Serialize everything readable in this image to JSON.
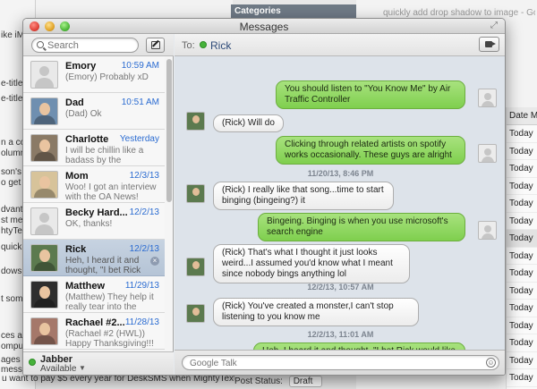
{
  "background": {
    "left_fragments": [
      "ike iM",
      "e-title.",
      "e-title.",
      "n a co",
      "olumn",
      "son's",
      "o get i",
      "dvanta",
      "st mes",
      "htyTex",
      "quick-re",
      "dows.",
      "t some",
      "ces ar",
      "omput",
      "ages w",
      "message"
    ],
    "categories_header": "Categories",
    "browser_tab": "quickly add drop shadow to image - Goog",
    "column_header": "Date M",
    "column_cells": [
      "Today",
      "Today",
      "Today",
      "Today",
      "Today",
      "Today",
      "Today",
      "Today",
      "Today",
      "Today",
      "Today",
      "Today",
      "Today",
      "Today",
      "Today"
    ],
    "post_status_label": "Post Status:",
    "post_status_value": "Draft",
    "bottom_text": "u want to pay $5 every year for DeskSMS when MightyText through a web app."
  },
  "window": {
    "title": "Messages"
  },
  "sidebar": {
    "search_placeholder": "Search",
    "conversations": [
      {
        "name": "Emory",
        "date": "10:59 AM",
        "preview": "(Emory) Probably xD",
        "avatar": "generic"
      },
      {
        "name": "Dad",
        "date": "10:51 AM",
        "preview": "(Dad) Ok",
        "avatar": "photo"
      },
      {
        "name": "Charlotte",
        "date": "Yesterday",
        "preview": "I will be chillin like a badass by the Donahu...",
        "avatar": "photo"
      },
      {
        "name": "Mom",
        "date": "12/3/13",
        "preview": "Woo! I got an interview with the OA News!",
        "avatar": "photo"
      },
      {
        "name": "Becky Hard...",
        "date": "12/2/13",
        "preview": "OK, thanks!",
        "avatar": "generic"
      },
      {
        "name": "Rick",
        "date": "12/2/13",
        "preview": "Heh, I heard it and thought, \"I bet Rick wo...",
        "avatar": "photo",
        "selected": true
      },
      {
        "name": "Matthew",
        "date": "11/29/13",
        "preview": "(Matthew) They help it really tear into the asph...",
        "avatar": "photo"
      },
      {
        "name": "Rachael #2...",
        "date": "11/28/13",
        "preview": "(Rachael #2 (HWL)) Happy Thanksgiving!!!",
        "avatar": "photo"
      }
    ],
    "account": {
      "name": "Jabber",
      "status": "Available"
    }
  },
  "chat": {
    "to_label": "To:",
    "recipient": "Rick",
    "input_placeholder": "Google Talk",
    "messages": [
      {
        "dir": "out",
        "text": "You should listen to \"You Know Me\" by Air Traffic Controller"
      },
      {
        "dir": "in",
        "text": "(Rick) Will do"
      },
      {
        "dir": "out",
        "text": "Clicking through related artists on spotify works occasionally. These guys are alright"
      },
      {
        "dir": "ts",
        "text": "11/20/13, 8:46 PM"
      },
      {
        "dir": "in",
        "text": "(Rick) I really like that song...time to start binging (bingeing?) it"
      },
      {
        "dir": "out",
        "text": "Bingeing. Binging is when you use microsoft's search engine"
      },
      {
        "dir": "in",
        "text": "(Rick) That's what I thought it just looks weird...I assumed you'd know what I meant since nobody bings anything lol"
      },
      {
        "dir": "ts",
        "text": "12/2/13, 10:57 AM"
      },
      {
        "dir": "in",
        "text": "(Rick) You've created a monster,I can't stop listening to you know me"
      },
      {
        "dir": "ts",
        "text": "12/2/13, 11:01 AM"
      },
      {
        "dir": "out",
        "text": "Heh, I heard it and thought, \"I bet Rick would like this.\""
      }
    ]
  }
}
